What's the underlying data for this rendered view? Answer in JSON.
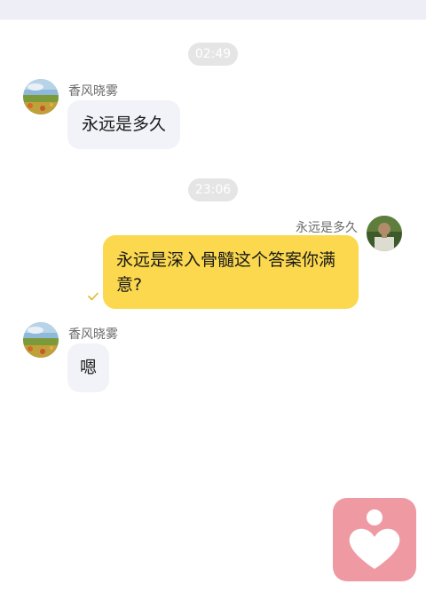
{
  "header": {
    "strip_color": "#eeeef6"
  },
  "messages": [
    {
      "type": "time",
      "text": "02:49"
    },
    {
      "type": "incoming",
      "sender": "香风晓雾",
      "text": "永远是多久"
    },
    {
      "type": "time",
      "text": "23:06"
    },
    {
      "type": "outgoing",
      "sender": "永远是多久",
      "text": "永远是深入骨髓这个答案你满意?",
      "status": "read-check"
    },
    {
      "type": "incoming",
      "sender": "香风晓雾",
      "text": "嗯"
    }
  ],
  "colors": {
    "outgoing_bubble": "#fbd84e",
    "incoming_bubble": "#f2f3f8",
    "time_pill": "#e5e5e5",
    "fab": "#ef9aa3",
    "check": "#e0b92a"
  },
  "icons": {
    "check": "check-icon",
    "fab": "heart-person-icon"
  }
}
